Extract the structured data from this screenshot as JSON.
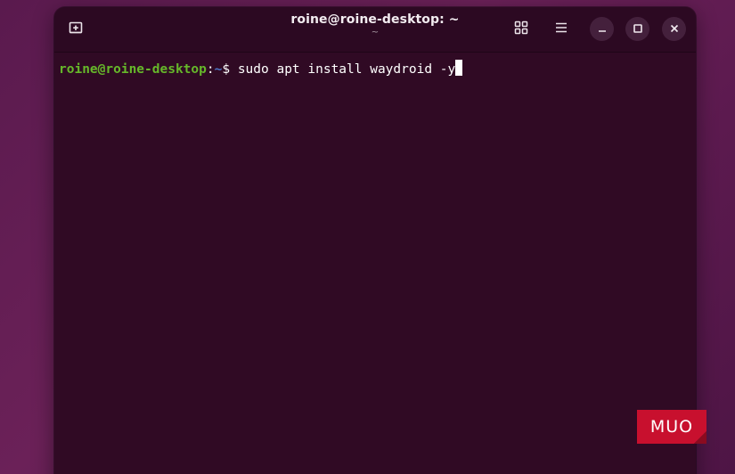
{
  "window": {
    "title": "roine@roine-desktop: ~",
    "subtitle": "~"
  },
  "toolbar": {
    "new_tab_icon": "new-tab-icon",
    "grid_icon": "grid-icon",
    "menu_icon": "hamburger-menu-icon",
    "minimize_icon": "minimize-icon",
    "maximize_icon": "maximize-icon",
    "close_icon": "close-icon"
  },
  "terminal": {
    "prompt_user_host": "roine@roine-desktop",
    "prompt_separator": ":",
    "prompt_path": "~",
    "prompt_symbol": "$ ",
    "command": "sudo apt install waydroid -y"
  },
  "watermark": {
    "text": "MUO"
  },
  "colors": {
    "terminal_bg": "#300a24",
    "prompt_green": "#66b82a",
    "prompt_blue": "#4d78c8",
    "watermark_red": "#c8102e"
  }
}
